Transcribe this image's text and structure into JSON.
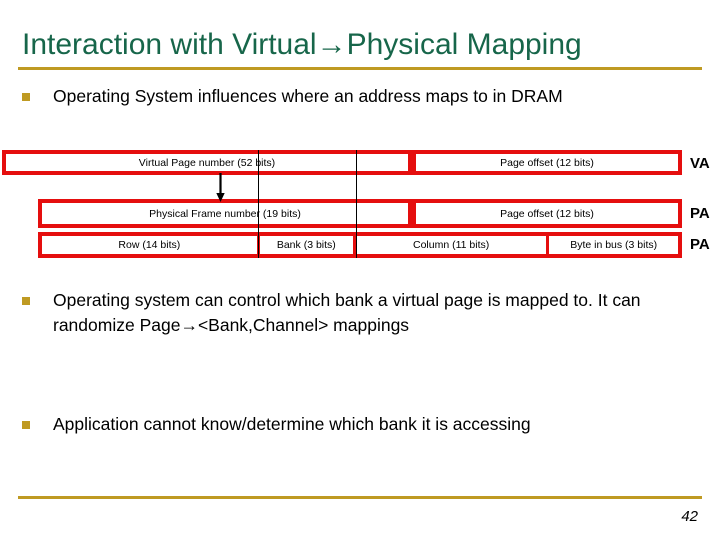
{
  "slide": {
    "title": "Interaction with Virtual→Physical Mapping",
    "page_number": "42",
    "accent_gold": "#bf9a22",
    "title_green": "#17664a",
    "diagram_red": "#e50e0e"
  },
  "bullets": [
    {
      "text": "Operating System influences where an address maps to in DRAM"
    },
    {
      "text": "Operating system can control which bank a virtual page is mapped to. It can randomize Page→<Bank,Channel> mappings"
    },
    {
      "text": "Application cannot know/determine which bank it is accessing"
    }
  ],
  "diagram": {
    "rows": [
      {
        "id": "va",
        "side_label": "VA",
        "fields": [
          {
            "label": "Virtual Page number (52 bits)",
            "flex": 402
          },
          {
            "label": "",
            "flex": 8,
            "gap": true
          },
          {
            "label": "Page offset (12 bits)",
            "flex": 262
          }
        ]
      },
      {
        "id": "pa1",
        "side_label": "PA",
        "fields": [
          {
            "label": "Physical Frame number (19 bits)",
            "flex": 366
          },
          {
            "label": "",
            "flex": 8,
            "gap": true
          },
          {
            "label": "Page offset (12 bits)",
            "flex": 262
          }
        ]
      },
      {
        "id": "pa2",
        "side_label": "PA",
        "fields": [
          {
            "label": "Row (14 bits)",
            "flex": 212
          },
          {
            "label": "",
            "flex": 3,
            "gap": true
          },
          {
            "label": "Bank (3 bits)",
            "flex": 92
          },
          {
            "label": "",
            "flex": 3,
            "gap": true
          },
          {
            "label": "Column (11 bits)",
            "flex": 188
          },
          {
            "label": "",
            "flex": 3,
            "gap": true
          },
          {
            "label": "Byte in bus (3 bits)",
            "flex": 127
          }
        ]
      }
    ],
    "arrow_name": "vpn-to-pfn-arrow"
  }
}
